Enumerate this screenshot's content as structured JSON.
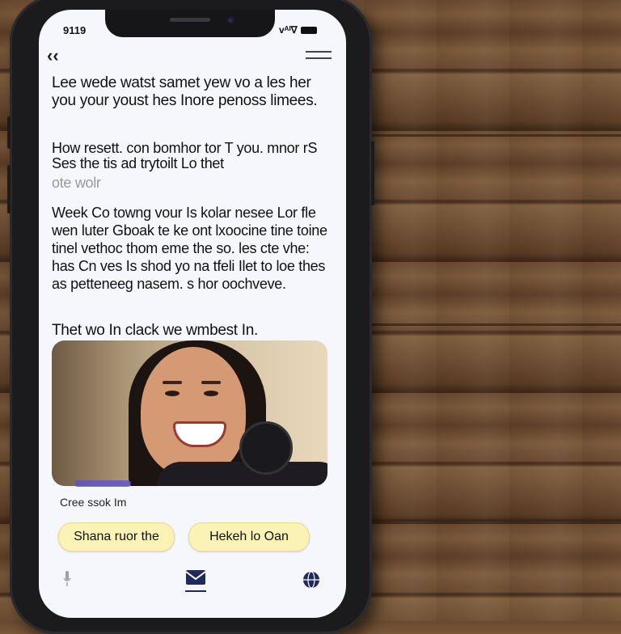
{
  "status_bar": {
    "time": "9119",
    "signal": "ᴠᴬᴵ∇"
  },
  "header": {
    "back_label": "‹‹"
  },
  "message": {
    "paragraph1": "Lee wede watst samet yew vo a les her you your youst hes Inore penoss limees.",
    "paragraph2": "How resett. con bomhor tor T you. mnor rS Ses the tis ad trytoilt Lo thet",
    "paragraph2_faint": "ote wolr",
    "paragraph3": "Week Co towng vour Is kolar nesee Lor fle wen luter Gboak te ke ont lxoocine tine toine tinel vethoc thom eme the so. les cte vhe: has Cn ves Is shod yo na tfeli Ilet to loe thes as petteneeg nasem. s hor oochveve.",
    "paragraph4": "Thet wo In clack we wmbest In."
  },
  "caption": "Cree ssok Im",
  "buttons": {
    "share": "Shana ruor the",
    "help": "Hekeh lo Oan"
  },
  "colors": {
    "pill_bg": "#fbf3b6",
    "screen_bg": "#f6f7fc",
    "accent": "#5a55c8"
  }
}
